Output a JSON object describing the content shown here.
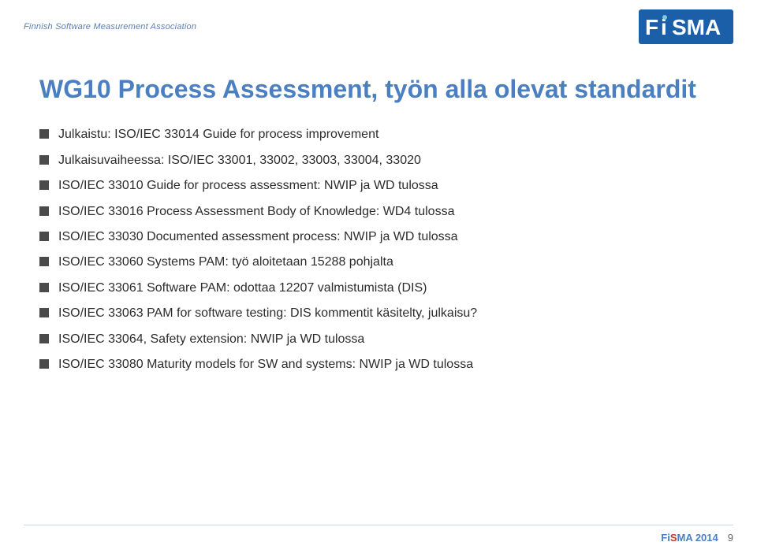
{
  "header": {
    "org_name": "Finnish Software Measurement Association"
  },
  "page": {
    "title": "WG10 Process Assessment, työn alla olevat standardit",
    "bullet_items": [
      "Julkaistu: ISO/IEC 33014 Guide for process improvement",
      "Julkaisuvaiheessa: ISO/IEC 33001, 33002, 33003, 33004, 33020",
      "ISO/IEC 33010 Guide for process assessment: NWIP ja WD tulossa",
      "ISO/IEC 33016 Process Assessment Body of Knowledge: WD4 tulossa",
      "ISO/IEC 33030 Documented assessment process: NWIP ja WD tulossa",
      "ISO/IEC 33060 Systems PAM: työ aloitetaan 15288 pohjalta",
      "ISO/IEC 33061 Software PAM: odottaa 12207 valmistumista (DIS)",
      "ISO/IEC 33063 PAM for software testing: DIS kommentit käsitelty, julkaisu?",
      "ISO/IEC 33064, Safety extension: NWIP ja WD tulossa",
      "ISO/IEC 33080 Maturity models  for SW and systems: NWIP ja WD tulossa"
    ]
  },
  "footer": {
    "brand": "FiSMA 2014",
    "page_number": "9"
  }
}
